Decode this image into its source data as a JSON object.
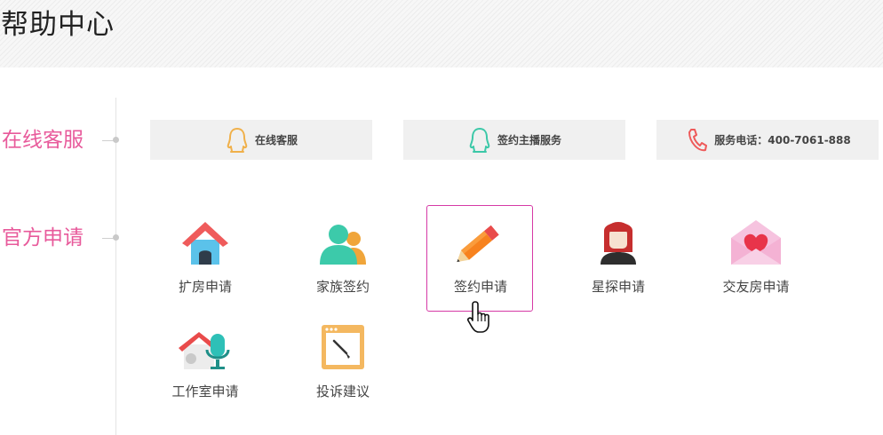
{
  "header": {
    "title": "帮助中心"
  },
  "sections": {
    "online": {
      "label": "在线客服"
    },
    "official": {
      "label": "官方申请"
    }
  },
  "services": [
    {
      "label": "在线客服",
      "icon": "qq-outline-icon",
      "color": "#f0b04a"
    },
    {
      "label": "签约主播服务",
      "icon": "qq-outline-icon",
      "color": "#3cc8a8"
    },
    {
      "label": "服务电话：400-7061-888",
      "icon": "phone-icon",
      "color": "#ee5a5a"
    }
  ],
  "apps": [
    {
      "label": "扩房申请",
      "icon": "house-icon"
    },
    {
      "label": "家族签约",
      "icon": "family-users-icon"
    },
    {
      "label": "签约申请",
      "icon": "pencil-icon",
      "selected": true
    },
    {
      "label": "星探申请",
      "icon": "woman-avatar-icon"
    },
    {
      "label": "交友房申请",
      "icon": "heart-envelope-icon"
    },
    {
      "label": "工作室申请",
      "icon": "studio-mic-icon"
    },
    {
      "label": "投诉建议",
      "icon": "complaint-board-icon"
    }
  ]
}
